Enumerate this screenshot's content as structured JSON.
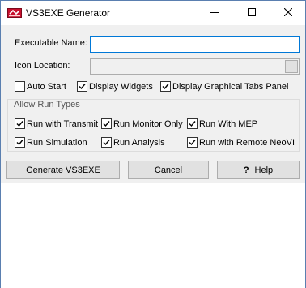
{
  "window": {
    "title": "VS3EXE Generator"
  },
  "title_controls": {
    "minimize_icon": "minimize-icon",
    "maximize_icon": "maximize-icon",
    "close_icon": "close-icon"
  },
  "form": {
    "executable_name": {
      "label": "Executable Name:",
      "value": ""
    },
    "icon_location": {
      "label": "Icon Location:",
      "value": ""
    }
  },
  "options": [
    {
      "label": "Auto Start",
      "checked": false
    },
    {
      "label": "Display Widgets",
      "checked": true
    },
    {
      "label": "Display Graphical Tabs Panel",
      "checked": true
    }
  ],
  "run_types": {
    "title": "Allow Run Types",
    "items": [
      {
        "label": "Run with Transmit",
        "checked": true
      },
      {
        "label": "Run Monitor Only",
        "checked": true
      },
      {
        "label": "Run With MEP",
        "checked": true
      },
      {
        "label": "Run Simulation",
        "checked": true
      },
      {
        "label": "Run Analysis",
        "checked": true
      },
      {
        "label": "Run with Remote NeoVI",
        "checked": true
      }
    ]
  },
  "buttons": {
    "generate": "Generate VS3EXE",
    "cancel": "Cancel",
    "help": "Help",
    "help_glyph": "?"
  },
  "colors": {
    "accent": "#0078d7",
    "button_face": "#e1e1e1",
    "window_bg": "#f0f0f0"
  }
}
